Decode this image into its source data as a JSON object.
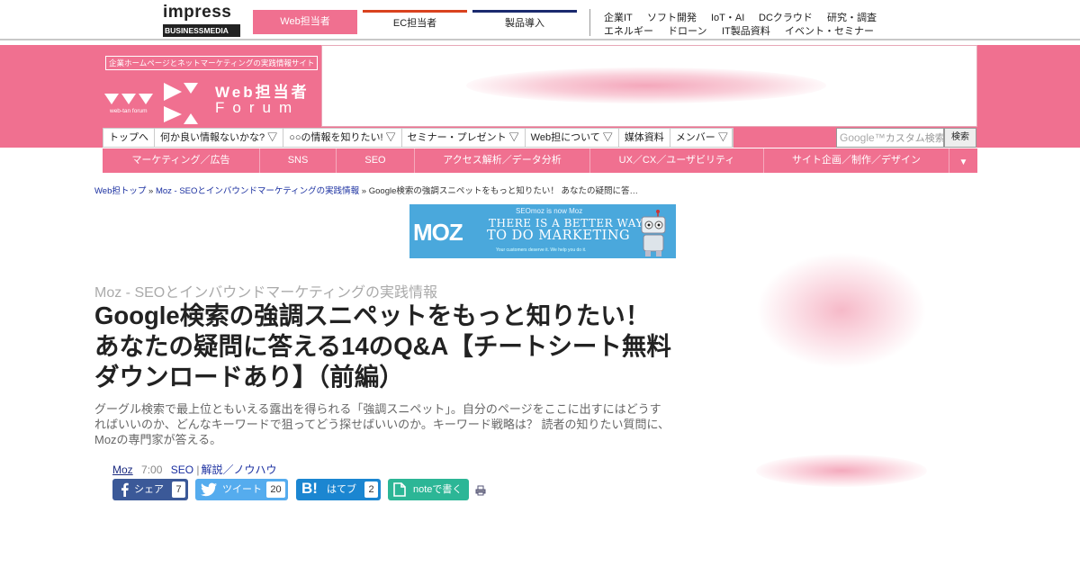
{
  "topbar": {
    "logo": {
      "line1": "impress",
      "line2": "BUSINESSMEDIA"
    },
    "site_tabs": [
      {
        "label": "Web担当者",
        "color": "#f07090"
      },
      {
        "label": "EC担当者",
        "color": "#d9421f"
      },
      {
        "label": "製品導入",
        "color": "#1a2a6e"
      }
    ],
    "categories_row1": [
      "企業IT",
      "ソフト開発",
      "IoT・AI",
      "DCクラウド",
      "研究・調査"
    ],
    "categories_row2": [
      "エネルギー",
      "ドローン",
      "IT製品資料",
      "イベント・セミナー"
    ]
  },
  "header": {
    "tagline": "企業ホームページとネットマーケティングの実践情報サイト",
    "logo_title": "Web担当者",
    "logo_subtitle": "Forum",
    "logo_small": "web-tan forum",
    "accent_color": "#f07090"
  },
  "main_nav": [
    "トップへ",
    "何か良い情報ないかな? ▽",
    "○○の情報を知りたい! ▽",
    "セミナー・プレゼント ▽",
    "Web担について ▽",
    "媒体資料",
    "メンバー ▽"
  ],
  "search": {
    "placeholder": "カスタム検索",
    "brand": "Google™",
    "button_label": "検索"
  },
  "category_nav": [
    "マーケティング／広告",
    "SNS",
    "SEO",
    "アクセス解析／データ分析",
    "UX／CX／ユーザビリティ",
    "サイト企画／制作／デザイン",
    "▼"
  ],
  "breadcrumb": {
    "home": "Web担トップ",
    "section": "Moz - SEOとインバウンドマーケティングの実践情報",
    "current": "Google検索の強調スニペットをもっと知りたい！ あなたの疑問に答…",
    "separator": "»"
  },
  "banner": {
    "logo": "MOZ",
    "top_text": "SEOmoz is now Moz",
    "line1": "THERE IS A BETTER WAY",
    "line2": "TO DO MARKETING",
    "line3": "Your customers deserve it. We help you do it."
  },
  "article": {
    "section_label": "Moz - SEOとインバウンドマーケティングの実践情報",
    "title": "Google検索の強調スニペットをもっと知りたい！ あなたの疑問に答える14のQ&A【チートシート無料ダウンロードあり】（前編）",
    "summary": "グーグル検索で最上位ともいえる露出を得られる「強調スニペット」。自分のページをここに出すにはどうすればいいのか、どんなキーワードで狙ってどう探せばいいのか。キーワード戦略は？ 読者の知りたい質問に、Mozの専門家が答える。",
    "author": "Moz",
    "time": "7:00",
    "tag1": "SEO",
    "tag_sep": "|",
    "tag2": "解説／ノウハウ"
  },
  "share": {
    "facebook": {
      "label": "シェア",
      "count": "7"
    },
    "twitter": {
      "label": "ツイート",
      "count": "20"
    },
    "hatena": {
      "label": "はてブ",
      "count": "2"
    },
    "note": {
      "label": "noteで書く"
    }
  }
}
